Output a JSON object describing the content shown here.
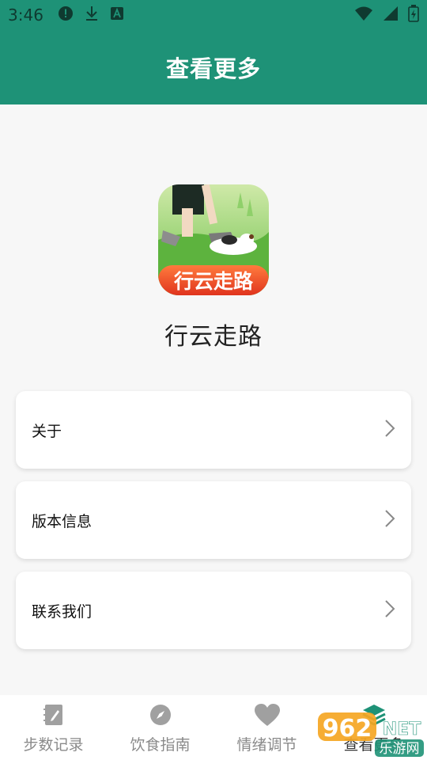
{
  "status_bar": {
    "time": "3:46",
    "icons": [
      "alert-icon",
      "download-icon",
      "text-a-icon",
      "wifi-icon",
      "signal-icon",
      "battery-icon"
    ]
  },
  "header": {
    "title": "查看更多"
  },
  "app": {
    "logo_text": "行云走路",
    "name": "行云走路"
  },
  "menu": {
    "items": [
      {
        "label": "关于"
      },
      {
        "label": "版本信息"
      },
      {
        "label": "联系我们"
      }
    ]
  },
  "tabbar": {
    "tabs": [
      {
        "label": "步数记录",
        "icon": "notebook-pen-icon",
        "active": false
      },
      {
        "label": "饮食指南",
        "icon": "compass-icon",
        "active": false
      },
      {
        "label": "情绪调节",
        "icon": "heart-icon",
        "active": false
      },
      {
        "label": "查看更多",
        "icon": "layers-icon",
        "active": true
      }
    ]
  },
  "watermark": {
    "number": "962",
    "suffix": "NET",
    "text": "乐游网"
  },
  "colors": {
    "primary": "#1e9277",
    "tab_inactive": "#8a8a8a",
    "page_bg": "#f7f7f7"
  }
}
